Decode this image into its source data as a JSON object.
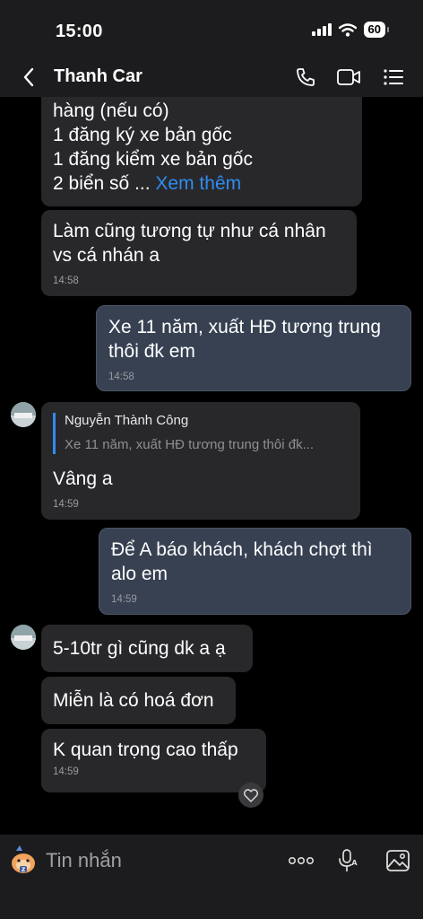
{
  "status": {
    "time": "15:00",
    "battery": "60"
  },
  "header": {
    "title": "Thanh Car"
  },
  "messages": {
    "m1": {
      "lines": [
        "hàng (nếu có)",
        "1 đăng ký xe bản gốc",
        "1 đăng kiểm xe bản gốc",
        "2 biển số ..."
      ],
      "see_more": "Xem thêm"
    },
    "m2": {
      "text": "Làm cũng tương tự như cá nhân vs cá nhán a",
      "time": "14:58"
    },
    "m3": {
      "text": "Xe 11 năm, xuất HĐ tương trung thôi đk em",
      "time": "14:58"
    },
    "m4": {
      "quote_author": "Nguyễn Thành Công",
      "quote_text": "Xe 11 năm, xuất HĐ tương trung thôi đk...",
      "text": "Vâng a",
      "time": "14:59"
    },
    "m5": {
      "text": "Để A báo khách, khách chợt thì alo em",
      "time": "14:59"
    },
    "m6": {
      "text": "5-10tr gì cũng dk a ạ"
    },
    "m7": {
      "text": "Miễn là có hoá đơn"
    },
    "m8": {
      "text": "K quan trọng cao thấp",
      "time": "14:59"
    }
  },
  "input": {
    "placeholder": "Tin nhắn"
  },
  "colors": {
    "link": "#2f8cf0",
    "incoming_bubble": "#28282b",
    "outgoing_bubble": "#374152",
    "bar": "#1c1c1e"
  },
  "icons": [
    "back-icon",
    "phone-icon",
    "video-icon",
    "menu-list-icon",
    "heart-icon",
    "sticker-icon",
    "more-icon",
    "voice-icon",
    "image-icon"
  ]
}
